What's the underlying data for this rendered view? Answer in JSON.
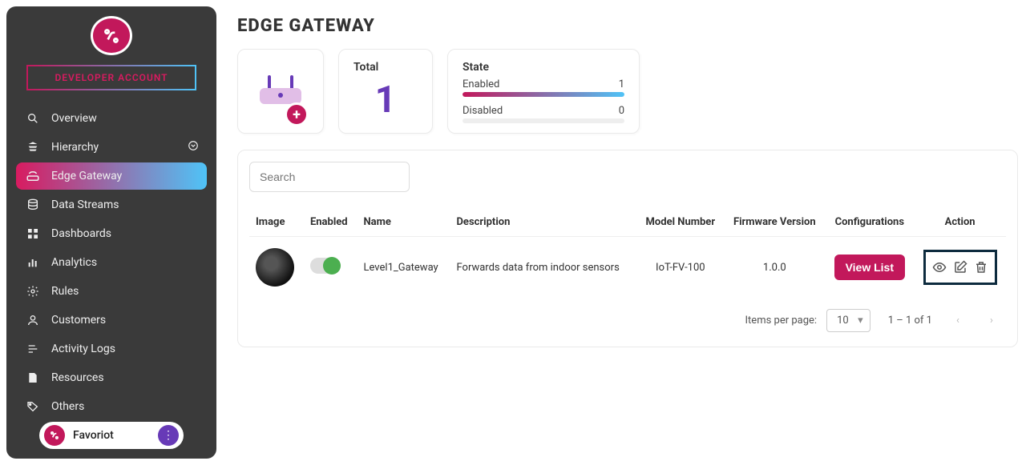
{
  "sidebar": {
    "account_label": "DEVELOPER ACCOUNT",
    "items": [
      {
        "label": "Overview",
        "icon": "search-icon"
      },
      {
        "label": "Hierarchy",
        "icon": "hierarchy-icon",
        "has_expand": true
      },
      {
        "label": "Edge Gateway",
        "icon": "gateway-icon",
        "active": true
      },
      {
        "label": "Data Streams",
        "icon": "database-icon"
      },
      {
        "label": "Dashboards",
        "icon": "dashboard-icon"
      },
      {
        "label": "Analytics",
        "icon": "analytics-icon"
      },
      {
        "label": "Rules",
        "icon": "gear-icon"
      },
      {
        "label": "Customers",
        "icon": "customers-icon"
      },
      {
        "label": "Activity Logs",
        "icon": "logs-icon"
      },
      {
        "label": "Resources",
        "icon": "resources-icon"
      },
      {
        "label": "Others",
        "icon": "tag-icon"
      }
    ],
    "footer_label": "Favoriot"
  },
  "page_title": "EDGE GATEWAY",
  "summary": {
    "total_label": "Total",
    "total_value": "1",
    "state_label": "State",
    "enabled_label": "Enabled",
    "enabled_value": "1",
    "disabled_label": "Disabled",
    "disabled_value": "0"
  },
  "search_placeholder": "Search",
  "columns": {
    "image": "Image",
    "enabled": "Enabled",
    "name": "Name",
    "description": "Description",
    "model": "Model Number",
    "firmware": "Firmware Version",
    "config": "Configurations",
    "action": "Action"
  },
  "rows": [
    {
      "name": "Level1_Gateway",
      "description": "Forwards data from indoor sensors",
      "model": "IoT-FV-100",
      "firmware": "1.0.0",
      "view_list_label": "View List"
    }
  ],
  "pager": {
    "items_per_page_label": "Items per page:",
    "items_per_page_value": "10",
    "range": "1 – 1 of 1"
  }
}
